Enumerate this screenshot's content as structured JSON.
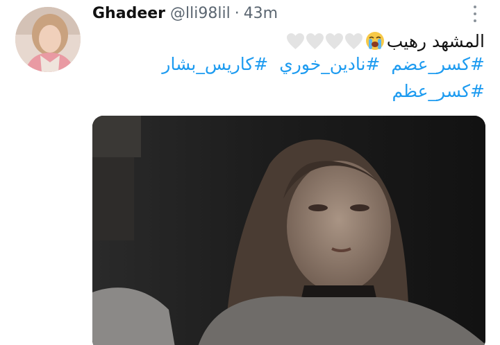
{
  "tweet": {
    "display_name": "Ghadeer",
    "handle": "@lli98lil",
    "separator": "·",
    "time": "43m",
    "text": "المشهد رهيب",
    "hashtags_line1": [
      "#كسر_عضم",
      "#نادين_خوري",
      "#كاريس_بشار"
    ],
    "hashtags_line2": [
      "#كسر_عظم"
    ]
  },
  "icons": {
    "more": "more-vertical-icon",
    "crying": "loudly-crying-face-emoji",
    "heart": "white-heart-emoji"
  },
  "colors": {
    "hashtag": "#1d9bf0",
    "name": "#111111",
    "meta": "#5b6671"
  }
}
